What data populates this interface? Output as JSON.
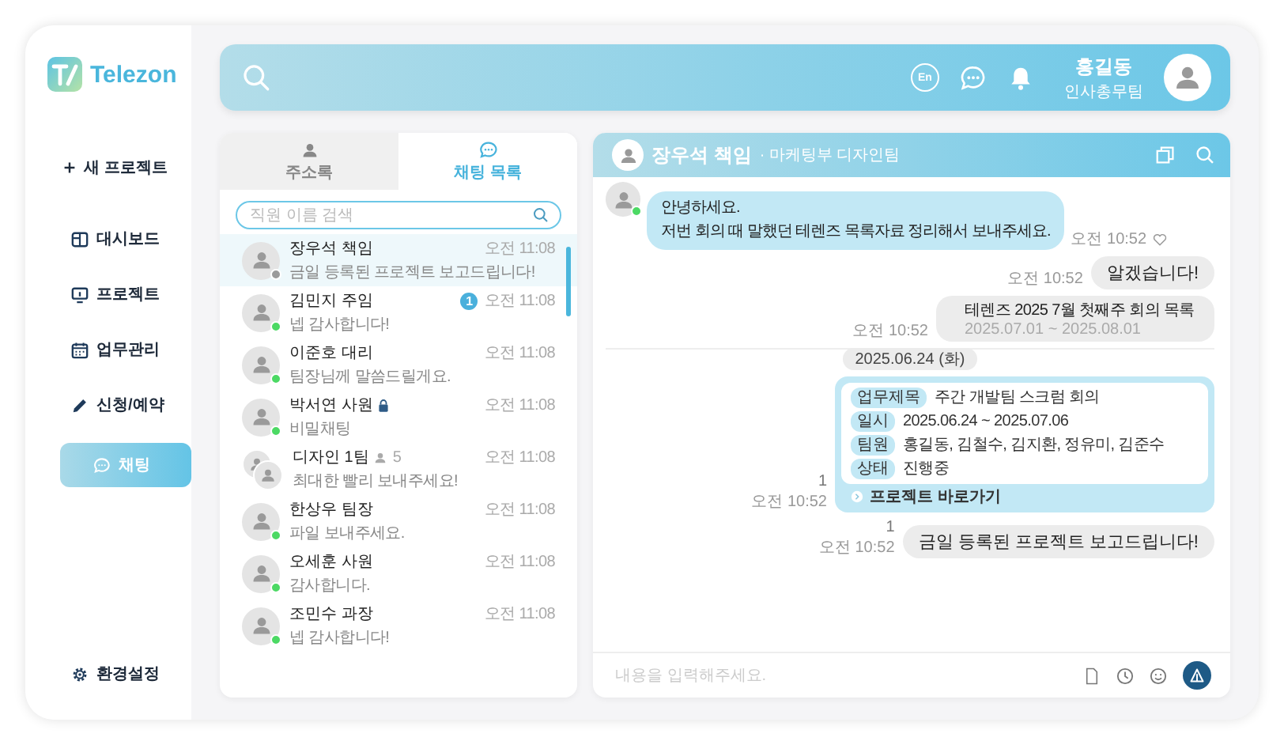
{
  "sidebar": {
    "logo": "Telezon",
    "new_project": "새 프로젝트",
    "items": [
      {
        "kind": "dashboard",
        "label": "대시보드",
        "selected": false
      },
      {
        "kind": "project",
        "label": "프로젝트",
        "selected": false
      },
      {
        "kind": "tasks",
        "label": "업무관리",
        "selected": false
      },
      {
        "kind": "booking",
        "label": "신청/예약",
        "selected": false
      },
      {
        "kind": "chat",
        "label": "채팅",
        "selected": true
      }
    ],
    "settings": "환경설정"
  },
  "header": {
    "language": "En",
    "user_name": "홍길동",
    "user_team": "인사총무팀"
  },
  "contact_tabs": [
    {
      "kind": "contacts",
      "label": "주소록",
      "selected": false
    },
    {
      "kind": "chats",
      "label": "채팅 목록",
      "selected": true
    }
  ],
  "contact_search": {
    "placeholder": "직원 이름 검색"
  },
  "chats": [
    {
      "kind": "person",
      "name": "장우석 책임",
      "preview": "금일 등록된 프로젝트 보고드립니다!",
      "time": "오전 11:08",
      "selected": true,
      "online": false,
      "locked": false
    },
    {
      "kind": "person",
      "name": "김민지 주임",
      "preview": "넵 감사합니다!",
      "time": "오전 11:08",
      "selected": false,
      "online": true,
      "locked": false,
      "unread": "1"
    },
    {
      "kind": "person",
      "name": "이준호 대리",
      "preview": "팀장님께 말씀드릴게요.",
      "time": "오전 11:08",
      "selected": false,
      "online": true,
      "locked": false
    },
    {
      "kind": "person",
      "name": "박서연 사원",
      "preview": "비밀채팅",
      "time": "오전 11:08",
      "selected": false,
      "online": true,
      "locked": true
    },
    {
      "kind": "group",
      "name": "디자인 1팀",
      "members": "5",
      "preview": "최대한 빨리 보내주세요!",
      "time": "오전 11:08",
      "selected": false,
      "locked": false
    },
    {
      "kind": "person",
      "name": "한상우 팀장",
      "preview": "파일 보내주세요.",
      "time": "오전 11:08",
      "selected": false,
      "online": true,
      "locked": false
    },
    {
      "kind": "person",
      "name": "오세훈 사원",
      "preview": "감사합니다.",
      "time": "오전 11:08",
      "selected": false,
      "online": true,
      "locked": false
    },
    {
      "kind": "person",
      "name": "조민수 과장",
      "preview": "넵 감사합니다!",
      "time": "오전 11:08",
      "selected": false,
      "online": true,
      "locked": false
    }
  ],
  "conversation": {
    "name": "장우석 책임",
    "team": "· 마케팅부 디자인팀",
    "messages": [
      {
        "kind": "incoming",
        "lines": [
          "안녕하세요.",
          "저번 회의 때 말했던 테렌즈 목록자료 정리해서 보내주세요."
        ],
        "time": "오전 10:52",
        "liked": false
      },
      {
        "kind": "outgoing",
        "text": "알겠습니다!",
        "time": "오전 10:52"
      },
      {
        "kind": "file",
        "title": "테렌즈 2025 7월 첫째주 회의 목록",
        "period": "2025.07.01 ~ 2025.08.01",
        "time": "오전 10:52"
      },
      {
        "kind": "date",
        "text": "2025.06.24 (화)"
      },
      {
        "kind": "card",
        "fields": [
          {
            "label": "업무제목",
            "value": "주간 개발팀 스크럼 회의"
          },
          {
            "label": "일시",
            "value": "2025.06.24 ~ 2025.07.06"
          },
          {
            "label": "팀원",
            "value": "홍길동, 김철수, 김지환, 정유미, 김준수"
          },
          {
            "label": "상태",
            "value": "진행중"
          }
        ],
        "link": "프로젝트 바로가기",
        "unread": "1",
        "time": "오전 10:52"
      },
      {
        "kind": "outgoing",
        "text": "금일 등록된 프로젝트 보고드립니다!",
        "unread": "1",
        "time": "오전 10:52"
      }
    ],
    "input": {
      "placeholder": "내용을 입력해주세요."
    }
  }
}
